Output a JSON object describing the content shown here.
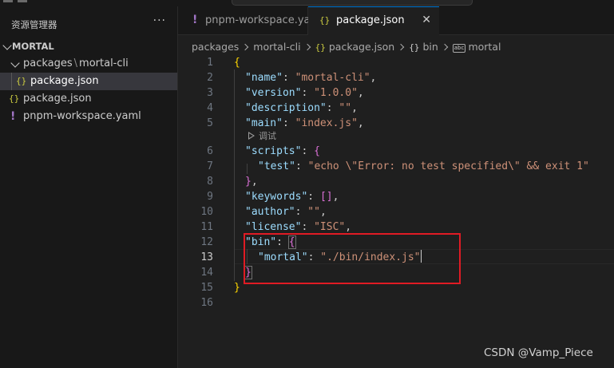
{
  "explorer": {
    "title": "资源管理器",
    "more": "···",
    "project": "MORTAL",
    "tree": [
      {
        "type": "folder",
        "label": "packages",
        "sub": "mortal-cli"
      },
      {
        "type": "json",
        "icon": "{}",
        "label": "package.json"
      },
      {
        "type": "json",
        "icon": "{}",
        "label": "package.json"
      },
      {
        "type": "yaml",
        "icon": "!",
        "label": "pnpm-workspace.yaml"
      }
    ],
    "path_sep": "\\"
  },
  "tabs": [
    {
      "icon": "!",
      "label": "pnpm-workspace.yaml",
      "active": false
    },
    {
      "icon": "{}",
      "label": "package.json",
      "active": true,
      "close": "✕"
    }
  ],
  "breadcrumb": {
    "items": [
      "packages",
      "mortal-cli"
    ],
    "file_icon": "{}",
    "file": "package.json",
    "key_icon": "{}",
    "key": "bin",
    "sym_icon": "abc",
    "sym": "mortal"
  },
  "editor": {
    "line_numbers": [
      "1",
      "2",
      "3",
      "4",
      "5",
      "6",
      "7",
      "8",
      "9",
      "10",
      "11",
      "12",
      "13",
      "14",
      "15",
      "16"
    ],
    "current_line": "13",
    "codelens": "调试",
    "code": {
      "l1": "{",
      "name_k": "\"name\"",
      "name_v": "\"mortal-cli\"",
      "version_k": "\"version\"",
      "version_v": "\"1.0.0\"",
      "desc_k": "\"description\"",
      "desc_v": "\"\"",
      "main_k": "\"main\"",
      "main_v": "\"index.js\"",
      "scripts_k": "\"scripts\"",
      "test_k": "\"test\"",
      "test_v": "\"echo \\\"Error: no test specified\\\" && exit 1\"",
      "keywords_k": "\"keywords\"",
      "author_k": "\"author\"",
      "author_v": "\"\"",
      "license_k": "\"license\"",
      "license_v": "\"ISC\"",
      "bin_k": "\"bin\"",
      "mortal_k": "\"mortal\"",
      "mortal_v": "\"./bin/index.js\"",
      "close": "}"
    }
  },
  "watermark": "CSDN @Vamp_Piece",
  "colors": {
    "accent": "#0078d4",
    "highlight_box": "#e01b24"
  }
}
